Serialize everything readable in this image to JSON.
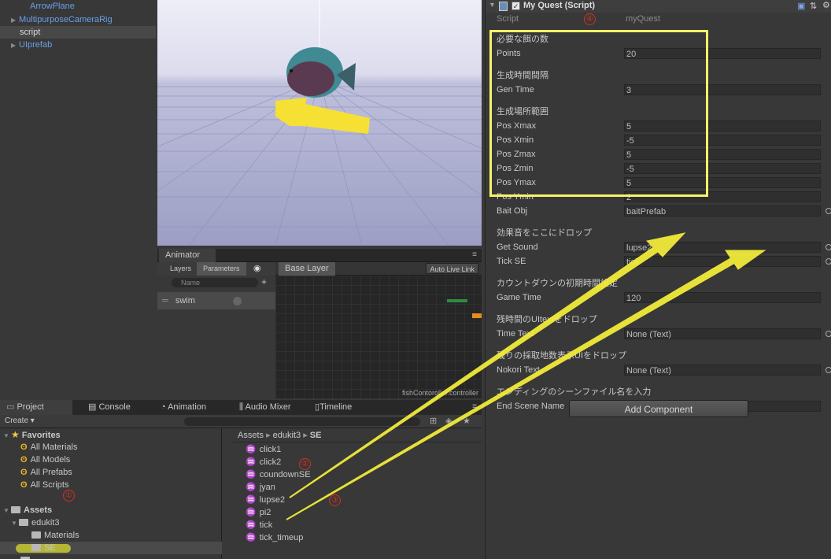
{
  "hierarchy": {
    "items": [
      {
        "label": "ArrowPlane",
        "style": "blue"
      },
      {
        "label": "MultipurposeCameraRig",
        "style": "blue"
      },
      {
        "label": "script",
        "style": "selected"
      },
      {
        "label": "UIprefab",
        "style": "blue"
      }
    ]
  },
  "animator": {
    "tab_label": "Animator",
    "left_tabs": [
      "Layers",
      "Parameters"
    ],
    "search_placeholder": "Name",
    "layer_label": "Base Layer",
    "auto_live_link": "Auto Live Link",
    "param_name": "swim",
    "controller_name": "fishContoroller.controller"
  },
  "project": {
    "tabs": [
      "Project",
      "Console",
      "Animation",
      "Audio Mixer",
      "Timeline"
    ],
    "create_label": "Create",
    "favorites_label": "Favorites",
    "favorites": [
      "All Materials",
      "All Models",
      "All Prefabs",
      "All Scripts"
    ],
    "assets_label": "Assets",
    "tree": [
      "edukit3",
      "Materials",
      "SE"
    ],
    "breadcrumb": [
      "Assets",
      "edukit3",
      "SE"
    ],
    "files": [
      "click1",
      "click2",
      "coundownSE",
      "jyan",
      "lupse2",
      "pi2",
      "tick",
      "tick_timeup"
    ]
  },
  "inspector": {
    "component_title": "My Quest (Script)",
    "script_label": "Script",
    "script_value": "myQuest",
    "rows": [
      {
        "kind": "header",
        "label": "必要な餌の数"
      },
      {
        "kind": "field",
        "label": "Points",
        "value": "20"
      },
      {
        "kind": "header",
        "label": "生成時間間隔"
      },
      {
        "kind": "field",
        "label": "Gen Time",
        "value": "3"
      },
      {
        "kind": "header",
        "label": "生成場所範囲"
      },
      {
        "kind": "field",
        "label": "Pos Xmax",
        "value": "5"
      },
      {
        "kind": "field",
        "label": "Pos Xmin",
        "value": "-5"
      },
      {
        "kind": "field",
        "label": "Pos Zmax",
        "value": "5"
      },
      {
        "kind": "field",
        "label": "Pos Zmin",
        "value": "-5"
      },
      {
        "kind": "field",
        "label": "Pos Ymax",
        "value": "5"
      },
      {
        "kind": "field",
        "label": "Pos Ymin",
        "value": "2"
      },
      {
        "kind": "field",
        "label": "Bait Obj",
        "value": "baitPrefab"
      },
      {
        "kind": "header",
        "label": "効果音をここにドロップ"
      },
      {
        "kind": "field",
        "label": "Get Sound",
        "value": "lupse2"
      },
      {
        "kind": "field",
        "label": "Tick SE",
        "value": "tick"
      },
      {
        "kind": "header",
        "label": "カウントダウンの初期時間設定"
      },
      {
        "kind": "field",
        "label": "Game Time",
        "value": "120"
      },
      {
        "kind": "header",
        "label": "残時間のUItextをドロップ"
      },
      {
        "kind": "field",
        "label": "Time Text",
        "value": "None (Text)"
      },
      {
        "kind": "header",
        "label": "残りの採取地数表示UIをドロップ"
      },
      {
        "kind": "field",
        "label": "Nokori Text",
        "value": "None (Text)"
      },
      {
        "kind": "header",
        "label": "エンディングのシーンファイル名を入力"
      },
      {
        "kind": "field",
        "label": "End Scene Name",
        "value": ""
      }
    ],
    "add_component": "Add Component"
  },
  "annotations": [
    "①",
    "②",
    "③",
    "④"
  ],
  "colors": {
    "highlight": "#f5f36a",
    "arrow": "#f6f03a",
    "annotation": "#d8301e",
    "link": "#6a9fe6"
  }
}
